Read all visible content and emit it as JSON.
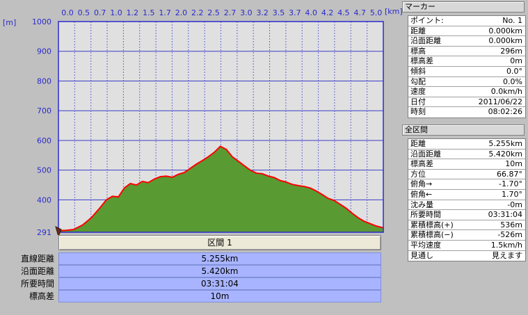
{
  "chart_data": {
    "type": "area",
    "x_unit": "[km]",
    "y_unit": "[m]",
    "x_ticks": [
      "0.0",
      "0.5",
      "0.7",
      "1.0",
      "1.2",
      "1.5",
      "1.7",
      "2.0",
      "2.2",
      "2.5",
      "2.7",
      "3.0",
      "3.2",
      "3.5",
      "3.7",
      "4.0",
      "4.2",
      "4.5",
      "4.7",
      "5.0"
    ],
    "y_ticks": [
      "1000",
      "900",
      "800",
      "700",
      "600",
      "500",
      "400",
      "291"
    ],
    "ylim": [
      291,
      1000
    ],
    "xlim": [
      0,
      5.42
    ],
    "x": [
      0.0,
      0.1,
      0.25,
      0.4,
      0.55,
      0.7,
      0.8,
      0.9,
      1.0,
      1.1,
      1.2,
      1.3,
      1.4,
      1.5,
      1.6,
      1.7,
      1.8,
      1.9,
      2.0,
      2.1,
      2.2,
      2.3,
      2.4,
      2.5,
      2.6,
      2.7,
      2.8,
      2.9,
      3.0,
      3.1,
      3.2,
      3.3,
      3.4,
      3.5,
      3.6,
      3.7,
      3.8,
      3.9,
      4.0,
      4.1,
      4.2,
      4.3,
      4.4,
      4.5,
      4.6,
      4.7,
      4.8,
      4.9,
      5.0,
      5.1,
      5.2,
      5.3,
      5.42
    ],
    "y": [
      296,
      297,
      300,
      315,
      340,
      375,
      400,
      412,
      410,
      440,
      455,
      450,
      462,
      458,
      470,
      478,
      480,
      476,
      486,
      492,
      506,
      520,
      532,
      545,
      560,
      580,
      570,
      545,
      530,
      515,
      500,
      490,
      488,
      480,
      475,
      465,
      460,
      452,
      448,
      445,
      440,
      430,
      418,
      405,
      398,
      385,
      372,
      355,
      340,
      328,
      320,
      312,
      306
    ],
    "line_color": "#ff0000",
    "fill_color": "#5a9a32",
    "grid": true,
    "bg_color": "#e0e0e0",
    "grid_color": "#3c3cc8"
  },
  "segment": {
    "header": "区間 1",
    "rows": [
      {
        "label": "直線距離",
        "value": "5.255km"
      },
      {
        "label": "沿面距離",
        "value": "5.420km"
      },
      {
        "label": "所要時間",
        "value": "03:31:04"
      },
      {
        "label": "標高差",
        "value": "10m"
      }
    ]
  },
  "marker": {
    "title": "マーカー",
    "rows": [
      {
        "k": "ポイント:",
        "v": "No. 1"
      },
      {
        "k": "距離",
        "v": "0.000km"
      },
      {
        "k": "沿面距離",
        "v": "0.000km"
      },
      {
        "k": "標高",
        "v": "296m"
      },
      {
        "k": "標高差",
        "v": "0m"
      },
      {
        "k": "傾斜",
        "v": "0.0°"
      },
      {
        "k": "勾配",
        "v": "0.0%"
      },
      {
        "k": "速度",
        "v": "0.0km/h"
      },
      {
        "k": "日付",
        "v": "2011/06/22"
      },
      {
        "k": "時刻",
        "v": "08:02:26"
      }
    ]
  },
  "all_segments": {
    "title": "全区間",
    "rows": [
      {
        "k": "距離",
        "v": "5.255km"
      },
      {
        "k": "沿面距離",
        "v": "5.420km"
      },
      {
        "k": "標高差",
        "v": "10m"
      },
      {
        "k": "方位",
        "v": "66.87°"
      },
      {
        "k": "俯角→",
        "v": "-1.70°"
      },
      {
        "k": "俯角←",
        "v": "1.70°"
      },
      {
        "k": "沈み量",
        "v": "-0m"
      },
      {
        "k": "所要時間",
        "v": "03:31:04"
      },
      {
        "k": "累積標高(+)",
        "v": "536m"
      },
      {
        "k": "累積標高(−)",
        "v": "-526m"
      },
      {
        "k": "平均速度",
        "v": "1.5km/h"
      },
      {
        "k": "見通し",
        "v": "見えます"
      }
    ]
  }
}
